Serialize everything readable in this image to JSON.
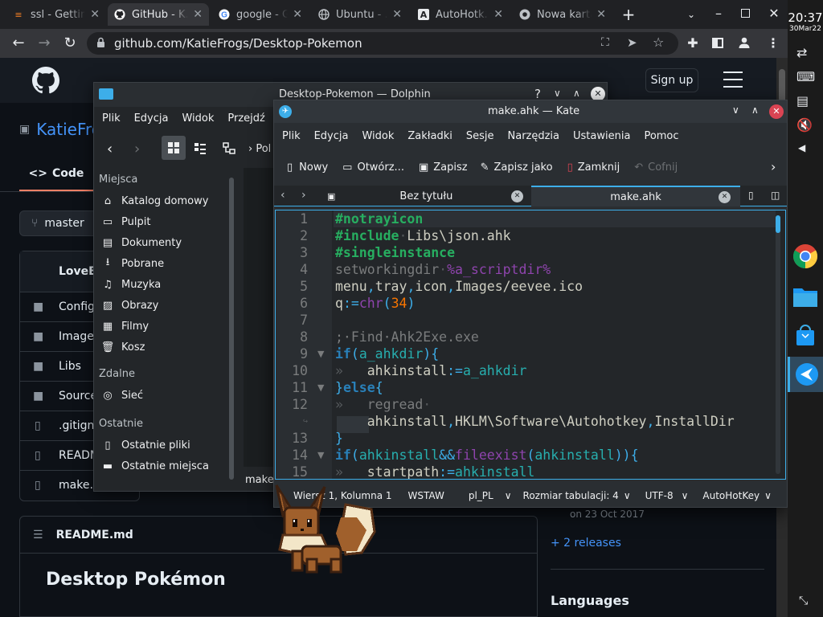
{
  "browser": {
    "tabs": [
      {
        "title": "ssl - Getting...",
        "icon": "stackoverflow-icon"
      },
      {
        "title": "GitHub - K...",
        "icon": "github-icon"
      },
      {
        "title": "google - G...",
        "icon": "google-icon"
      },
      {
        "title": "Ubuntu - ...",
        "icon": "globe-icon"
      },
      {
        "title": "AutoHotk...",
        "icon": "autohotkey-icon"
      },
      {
        "title": "Nowa karta",
        "icon": "chrome-icon"
      }
    ],
    "url": "github.com/KatieFrogs/Desktop-Pokemon"
  },
  "github": {
    "signup": "Sign up",
    "repo_owner": "KatieFro",
    "code_tab": "Code",
    "branch": "master",
    "commit_author": "LoveE",
    "files": [
      "Config",
      "Images",
      "Libs",
      "Source",
      ".gitigno",
      "READM",
      "make.a"
    ],
    "readme_label": "README.md",
    "readme_title": "Desktop Pokémon",
    "release_date": "on 23 Oct 2017",
    "releases_link": "+ 2 releases",
    "languages": "Languages"
  },
  "dolphin": {
    "title": "Desktop-Pokemon — Dolphin",
    "menu": [
      "Plik",
      "Edycja",
      "Widok",
      "Przejdź"
    ],
    "crumb": "Pol",
    "sections": [
      {
        "header": "Miejsca",
        "items": [
          {
            "label": "Katalog domowy",
            "icon": "home-icon"
          },
          {
            "label": "Pulpit",
            "icon": "desktop-icon"
          },
          {
            "label": "Dokumenty",
            "icon": "documents-icon"
          },
          {
            "label": "Pobrane",
            "icon": "downloads-icon"
          },
          {
            "label": "Muzyka",
            "icon": "music-icon"
          },
          {
            "label": "Obrazy",
            "icon": "pictures-icon"
          },
          {
            "label": "Filmy",
            "icon": "videos-icon"
          },
          {
            "label": "Kosz",
            "icon": "trash-icon"
          }
        ]
      },
      {
        "header": "Zdalne",
        "items": [
          {
            "label": "Sieć",
            "icon": "network-icon"
          }
        ]
      },
      {
        "header": "Ostatnie",
        "items": [
          {
            "label": "Ostatnie pliki",
            "icon": "recent-files-icon"
          },
          {
            "label": "Ostatnie miejsca",
            "icon": "recent-places-icon"
          }
        ]
      }
    ],
    "status_file": "make"
  },
  "kate": {
    "title": "make.ahk — Kate",
    "menu": [
      "Plik",
      "Edycja",
      "Widok",
      "Zakładki",
      "Sesje",
      "Narzędzia",
      "Ustawienia",
      "Pomoc"
    ],
    "toolbar": {
      "new": "Nowy",
      "open": "Otwórz...",
      "save": "Zapisz",
      "save_as": "Zapisz jako",
      "close": "Zamknij",
      "undo": "Cofnij"
    },
    "tabs": [
      "Bez tytułu",
      "make.ahk"
    ],
    "status": {
      "line_col": "Wiersz 1, Kolumna 1",
      "mode": "WSTAW",
      "lang": "pl_PL",
      "tab": "Rozmiar tabulacji: 4",
      "enc": "UTF-8",
      "syntax": "AutoHotKey"
    },
    "line_numbers": [
      "1",
      "2",
      "3",
      "4",
      "5",
      "6",
      "7",
      "8",
      "9",
      "10",
      "11",
      "12",
      "",
      "13",
      "14",
      "15"
    ]
  },
  "system": {
    "time": "20:37",
    "date": "30Mar22"
  }
}
